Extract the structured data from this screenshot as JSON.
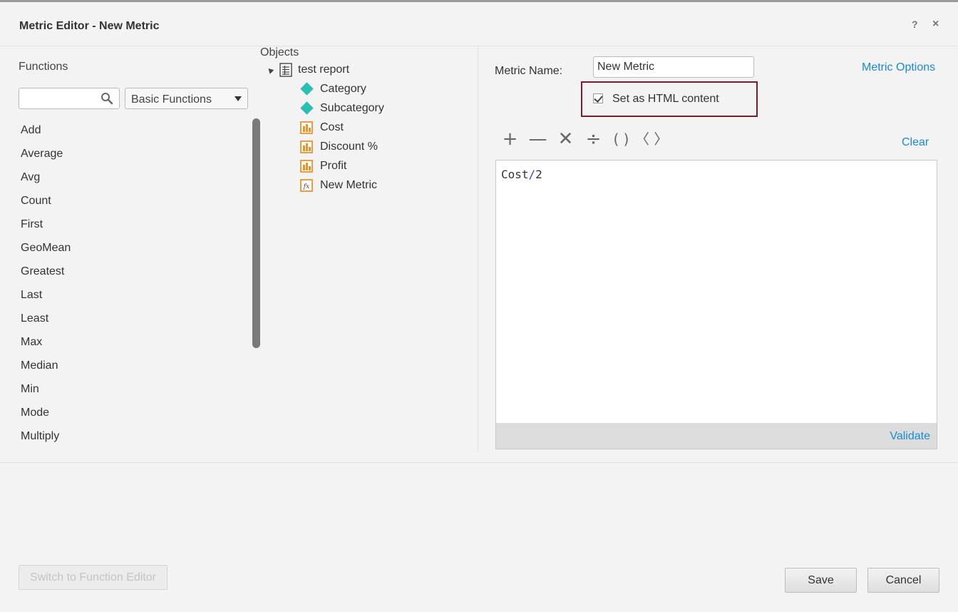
{
  "dialog": {
    "title": "Metric Editor - New Metric",
    "help_glyph": "?",
    "close_glyph": "×"
  },
  "functions": {
    "label": "Functions",
    "search_value": "",
    "category_selected": "Basic Functions",
    "items": [
      "Add",
      "Average",
      "Avg",
      "Count",
      "First",
      "GeoMean",
      "Greatest",
      "Last",
      "Least",
      "Max",
      "Median",
      "Min",
      "Mode",
      "Multiply"
    ]
  },
  "objects": {
    "label": "Objects",
    "root": {
      "label": "test report",
      "icon": "report-icon"
    },
    "items": [
      {
        "label": "Category",
        "icon": "attribute-icon"
      },
      {
        "label": "Subcategory",
        "icon": "attribute-icon"
      },
      {
        "label": "Cost",
        "icon": "metric-icon"
      },
      {
        "label": "Discount %",
        "icon": "metric-icon"
      },
      {
        "label": "Profit",
        "icon": "metric-icon"
      },
      {
        "label": "New Metric",
        "icon": "derived-metric-icon"
      }
    ]
  },
  "editor": {
    "metric_name_label": "Metric Name:",
    "metric_name_value": "New Metric",
    "metric_options": "Metric Options",
    "html_content_label": "Set as HTML content",
    "html_content_checked": true,
    "operators": [
      "+",
      "—",
      "✕",
      "÷",
      "( )",
      "〈 〉"
    ],
    "clear": "Clear",
    "formula": {
      "left": "Cost",
      "operator": "/",
      "right": "2"
    },
    "validate": "Validate"
  },
  "footer": {
    "switch": "Switch to Function Editor",
    "save": "Save",
    "cancel": "Cancel"
  },
  "colors": {
    "link": "#1a8bd1",
    "highlight_border": "#7a1c2e",
    "attribute_icon": "#2bbfb3",
    "metric_icon": "#f0902a"
  }
}
